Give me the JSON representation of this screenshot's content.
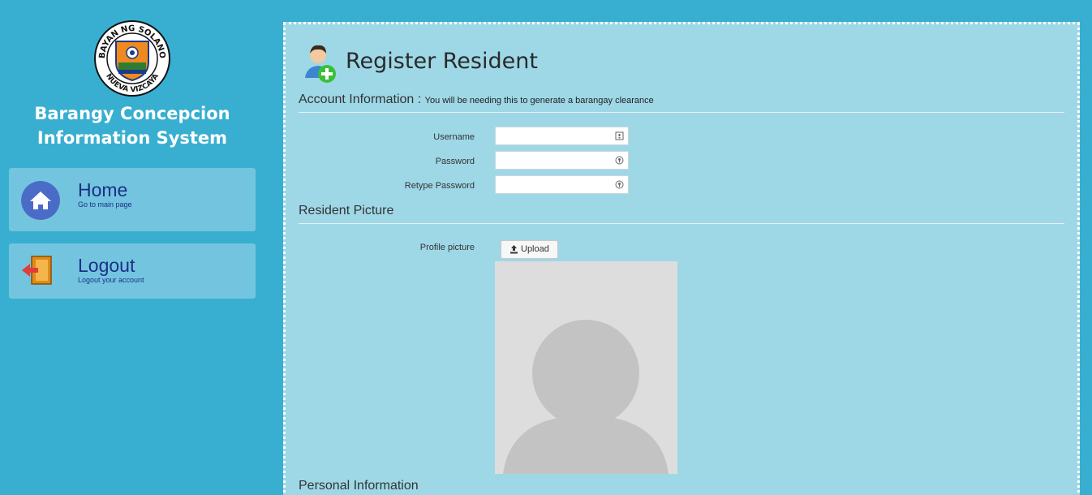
{
  "app": {
    "logo": {
      "top_text": "BAYAN NG SOLANO",
      "bottom_text": "NUEVA VIZCAYA"
    },
    "title_line1": "Barangy Concepcion",
    "title_line2": "Information System"
  },
  "nav": {
    "home": {
      "label": "Home",
      "sub": "Go to main page",
      "icon": "home-icon"
    },
    "logout": {
      "label": "Logout",
      "sub": "Logout your account",
      "icon": "door-exit-icon"
    }
  },
  "page": {
    "title": "Register Resident",
    "icon": "user-add-icon"
  },
  "account": {
    "heading": "Account Information :",
    "note": "You will be needing this to generate a barangay clearance",
    "fields": {
      "username_label": "Username",
      "username_value": "",
      "password_label": "Password",
      "password_value": "",
      "retype_label": "Retype Password",
      "retype_value": ""
    }
  },
  "picture": {
    "heading": "Resident Picture",
    "profile_label": "Profile picture",
    "upload_label": "Upload"
  },
  "personal": {
    "heading": "Personal Information"
  },
  "colors": {
    "background": "#38afd0",
    "panel": "#9ed8e7",
    "nav_card": "#73c5df",
    "nav_text": "#1c2f86"
  }
}
